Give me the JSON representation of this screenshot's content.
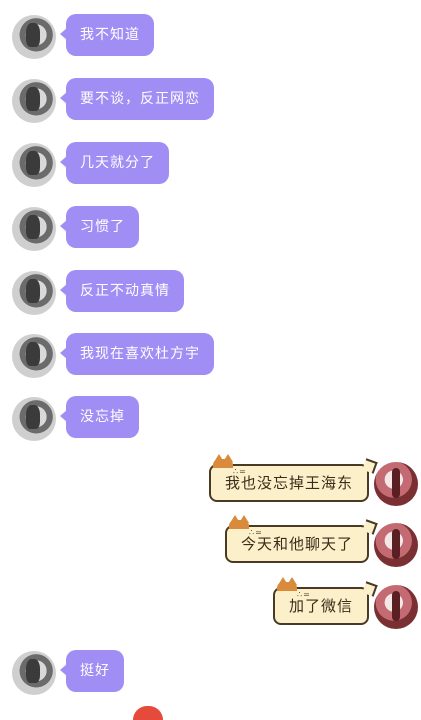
{
  "chat": {
    "left_messages": [
      {
        "text": "我不知道"
      },
      {
        "text": "要不谈，反正网恋"
      },
      {
        "text": "几天就分了"
      },
      {
        "text": "习惯了"
      },
      {
        "text": "反正不动真情"
      },
      {
        "text": "我现在喜欢杜方宇"
      },
      {
        "text": "没忘掉"
      }
    ],
    "right_messages": [
      {
        "text": "我也没忘掉王海东"
      },
      {
        "text": "今天和他聊天了"
      },
      {
        "text": "加了微信"
      }
    ],
    "last_left_message": {
      "text": "挺好"
    }
  },
  "colors": {
    "left_bubble": "#a08ef5",
    "right_bubble_fill": "#fbf0c9",
    "right_bubble_border": "#4a3a25"
  },
  "icons": {
    "left_avatar": "avatar-girl-photo",
    "right_avatar": "avatar-red-costume-photo",
    "bubble_decoration": "cat-ear-icon",
    "partial_sticker": "red-sticker-icon"
  }
}
